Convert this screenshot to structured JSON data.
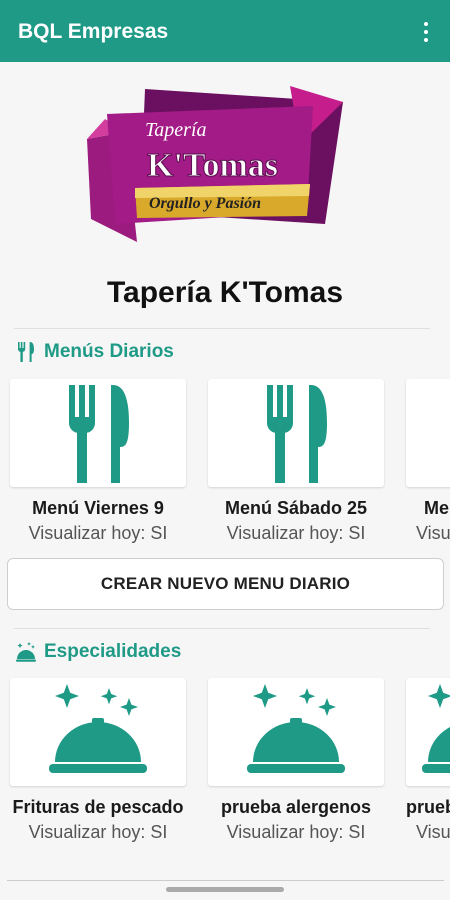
{
  "app": {
    "title": "BQL Empresas",
    "overflow_icon": "more-vert-icon"
  },
  "header": {
    "logo": {
      "line1": "Tapería",
      "line2": "K'Tomas",
      "tagline": "Orgullo y Pasión"
    },
    "business_name": "Tapería K'Tomas"
  },
  "daily_menus": {
    "title": "Menús Diarios",
    "icon": "fork-knife-icon",
    "items": [
      {
        "name": "Menú Viernes 9",
        "status": "Visualizar hoy: SI"
      },
      {
        "name": "Menú Sábado 25",
        "status": "Visualizar hoy: SI"
      },
      {
        "name": "Me",
        "status": "Visu"
      }
    ],
    "create_button": "CREAR NUEVO MENU DIARIO"
  },
  "specialties": {
    "title": "Especialidades",
    "icon": "cloche-icon",
    "items": [
      {
        "name": "Frituras de pescado",
        "status": "Visualizar hoy: SI"
      },
      {
        "name": "prueba alergenos",
        "status": "Visualizar hoy: SI"
      },
      {
        "name": "prueb",
        "status": "Visu"
      }
    ]
  },
  "colors": {
    "primary": "#1f9a87",
    "logo_magenta": "#8e1f7a",
    "logo_gold": "#e0b83a"
  }
}
